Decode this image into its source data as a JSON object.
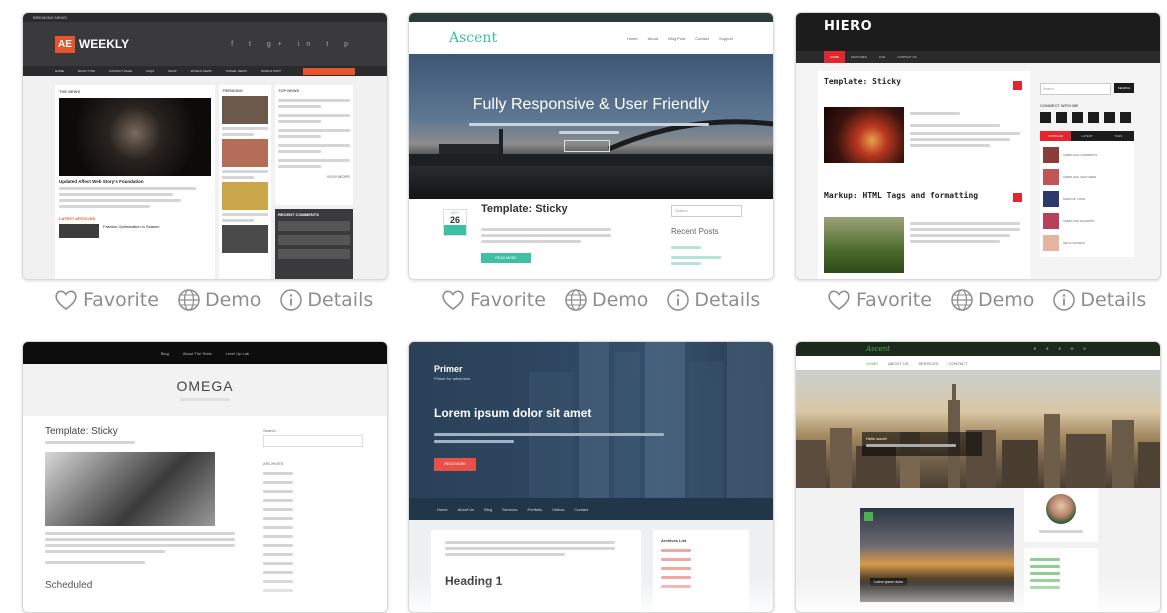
{
  "actions": {
    "favorite": "Favorite",
    "demo": "Demo",
    "details": "Details"
  },
  "themes": {
    "weekly": {
      "logo_badge": "AE",
      "logo_text": "WEEKLY",
      "top_left": "BREAKING NEWS",
      "nav": [
        "HOME",
        "BLOG TYPE",
        "CONTACT PAGE",
        "FAQS",
        "SHOP",
        "WORLD NEWS",
        "TRAVEL NEWS",
        "WORLD POST"
      ],
      "breadcrumb": "TIPS",
      "col1": "THE NEWS",
      "col2": "TRENDING",
      "col3": "TOP NEWS",
      "feature_title": "Updated Affect Web Story's Foundation",
      "section_label": "LATEST ARTICLES",
      "latest_item": "Fashion Optimization in Season",
      "recent_comments": "RECENT COMMENTS",
      "view_more": "VIEW MORE"
    },
    "ascent": {
      "logo": "Ascent",
      "nav": [
        "Home",
        "About",
        "Blog Post",
        "Contact",
        "Support"
      ],
      "hero_title": "Fully Responsive & User Friendly",
      "post_month": "OCT",
      "post_day": "26",
      "post_title": "Template: Sticky",
      "sidebar_search": "Search",
      "sidebar_heading": "Recent Posts",
      "read_more": "READ MORE"
    },
    "hiero": {
      "logo": "HIERO",
      "nav": [
        "HOME",
        "FEATURES",
        "LIVE",
        "CONTACT US"
      ],
      "post1_title": "Template: Sticky",
      "post2_title": "Markup: HTML Tags and formatting",
      "search_placeholder": "Search ...",
      "search_btn": "SEARCH",
      "connect_heading": "CONNECT WITH ME",
      "tabs": [
        "POPULAR",
        "LATEST",
        "TAGS"
      ],
      "list_items": [
        "TEMPLATE COMMENTS",
        "TEMPLATE: FEATURED",
        "MARKUP: HTML",
        "TEMPLATE: EXCERPT",
        "HELLO WORLD"
      ]
    },
    "omega": {
      "nav": [
        "Blog",
        "About The Tests",
        "Level Up Lab"
      ],
      "logo": "OMEGA",
      "post_title": "Template: Sticky",
      "search_label": "Search",
      "archives_heading": "ARCHIVES",
      "footer_heading": "Scheduled"
    },
    "primer": {
      "logo": "Primer",
      "tagline": "Primer for adventure",
      "hero_title": "Lorem ipsum dolor sit amet",
      "hero_btn": "READ MORE",
      "nav": [
        "Home",
        "About Us",
        "Blog",
        "Services",
        "Portfolio",
        "Videos",
        "Contact"
      ],
      "sidebar_heading": "Archives List",
      "heading": "Heading 1"
    },
    "ascent2": {
      "logo": "Ascent",
      "nav": [
        "HOME",
        "ABOUT US",
        "SERVICES",
        "CONTACT"
      ],
      "hero_caption": "Hello world!",
      "image_caption": "Lorem ipsum dolor"
    }
  },
  "colors": {
    "weekly_accent": "#e8542c",
    "weekly_dark": "#3a3a3d",
    "ascent_teal": "#3fbfa3",
    "hiero_red": "#e0262e",
    "primer_blue": "#2e4661",
    "primer_btn": "#e8504a",
    "icon_gray": "#8e8e8e"
  }
}
